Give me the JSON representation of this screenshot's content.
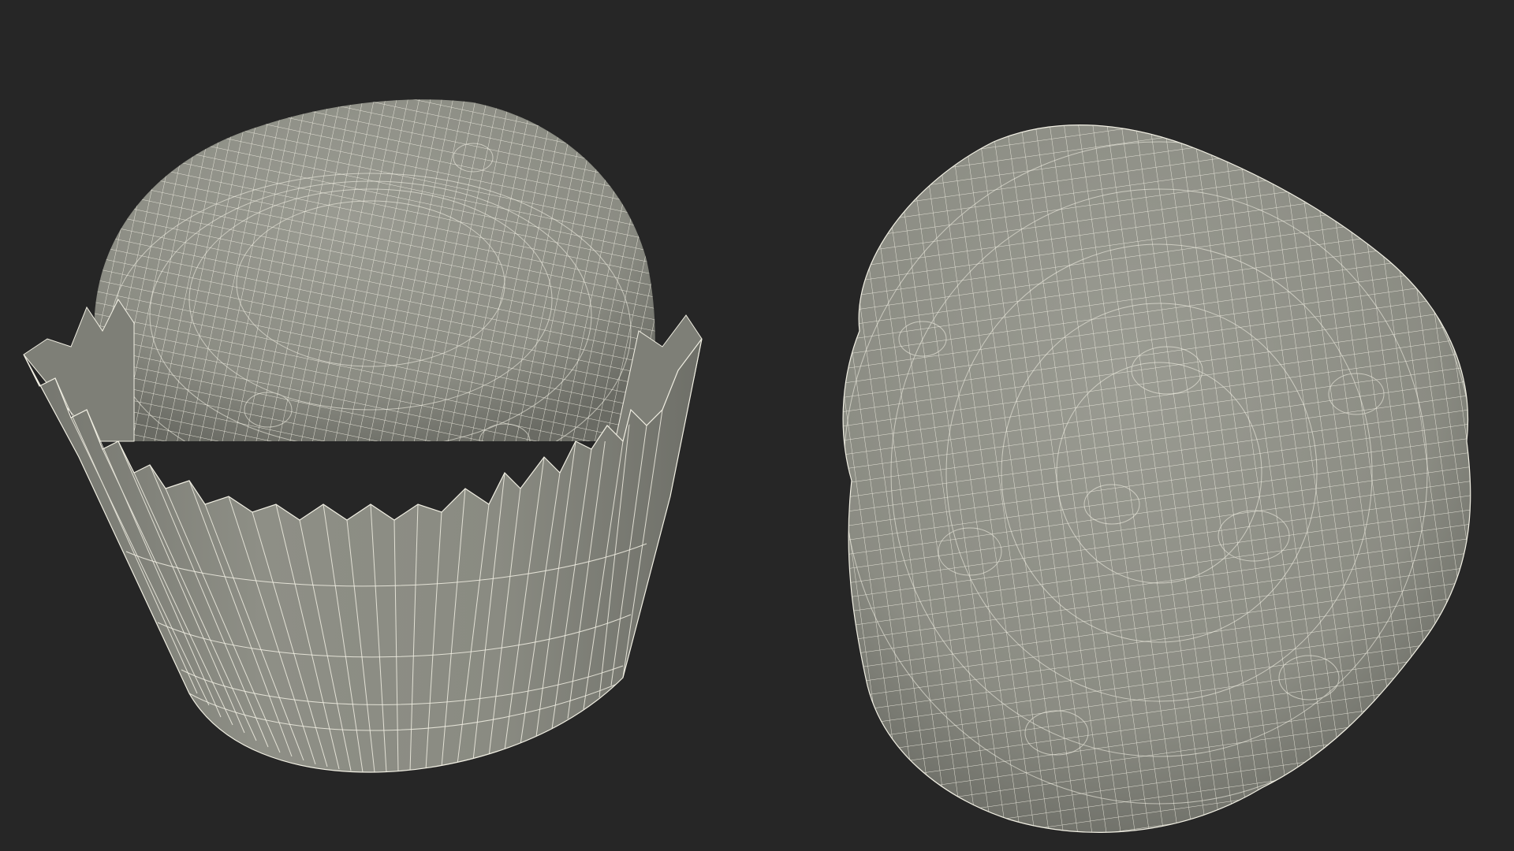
{
  "scene": {
    "background_color": "#262626",
    "mesh_fill_color": "#8f9087",
    "mesh_shadow_color": "#6f706a",
    "wire_color": "#f2f0e4",
    "objects": [
      {
        "name": "truffle-in-paper-cup",
        "icon": "wireframe-truffle-cup"
      },
      {
        "name": "truffle-ball",
        "icon": "wireframe-truffle-ball"
      }
    ]
  }
}
